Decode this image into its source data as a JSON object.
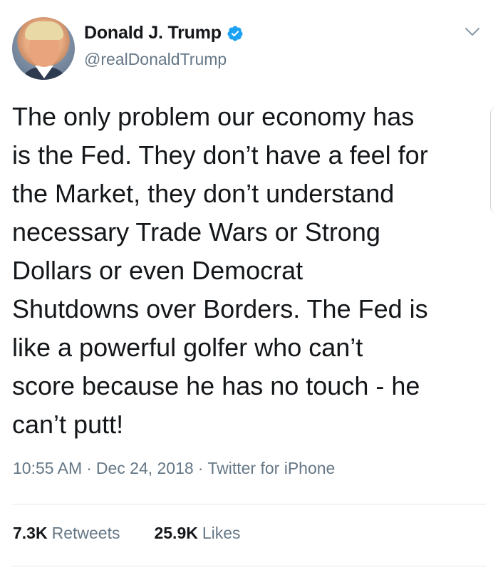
{
  "user": {
    "display_name": "Donald J. Trump",
    "handle": "@realDonaldTrump",
    "verified": true
  },
  "tweet": {
    "lines": [
      "The only problem our economy has",
      "is the Fed. They don’t have a feel for",
      "the Market, they don’t understand",
      "necessary Trade Wars or Strong",
      "Dollars or even Democrat",
      "Shutdowns over Borders. The Fed is",
      "like a powerful golfer who can’t",
      "score because he has no touch - he",
      "can’t putt!"
    ],
    "time": "10:55 AM",
    "date": "Dec 24, 2018",
    "source": "Twitter for iPhone",
    "separator": "·"
  },
  "stats": {
    "retweets_count": "7.3K",
    "retweets_label": "Retweets",
    "likes_count": "25.9K",
    "likes_label": "Likes"
  },
  "icons": {
    "verified": "verified-badge-icon",
    "menu": "chevron-down-icon"
  },
  "colors": {
    "primary_text": "#14171a",
    "secondary_text": "#657786",
    "verified_blue": "#1da1f2",
    "divider": "#e1e8ed"
  }
}
